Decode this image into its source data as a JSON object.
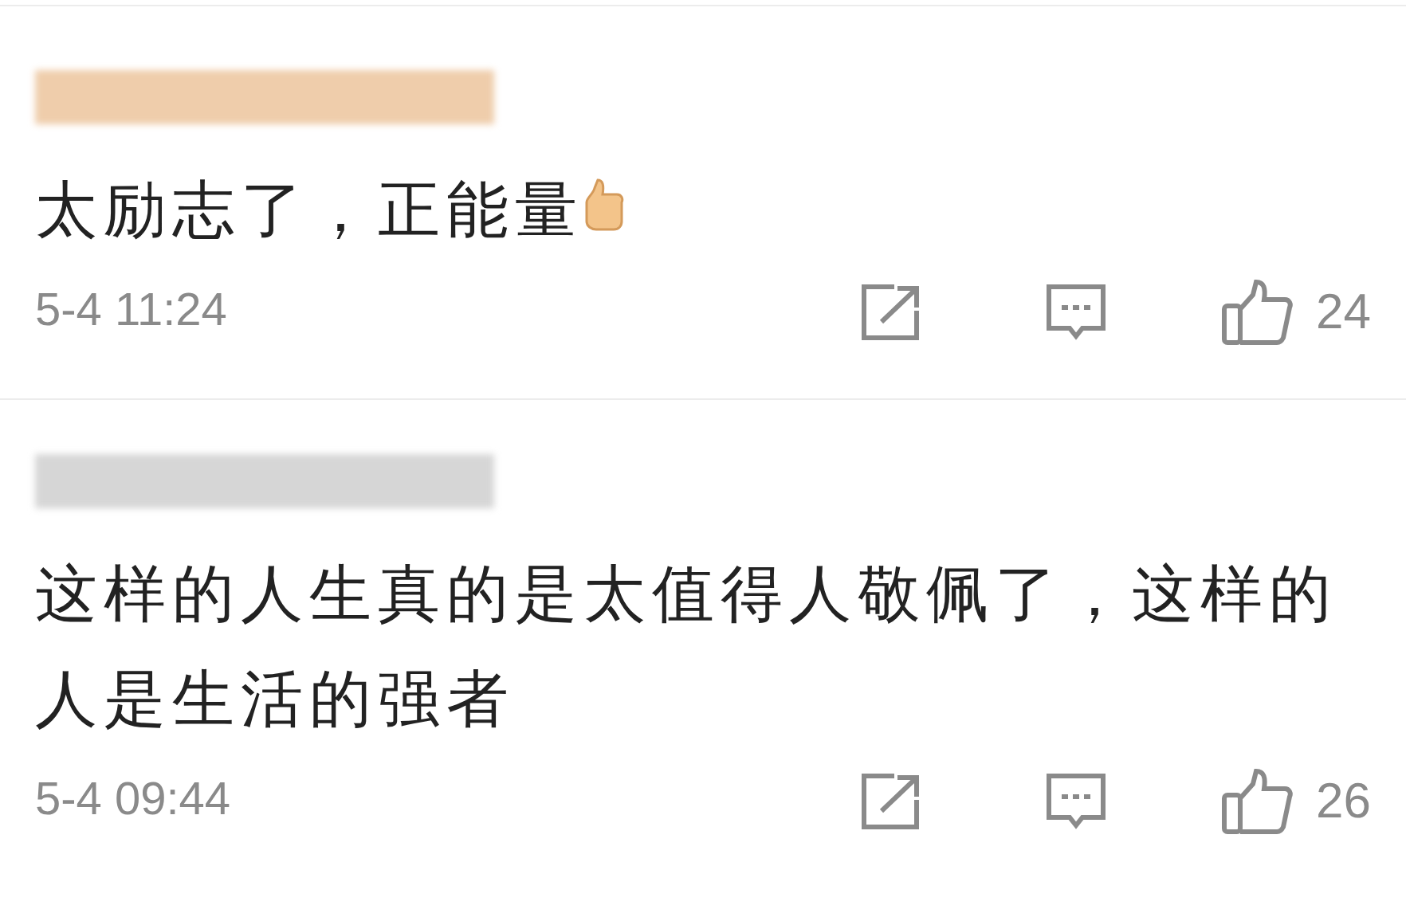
{
  "comments": [
    {
      "color": "#efcdab",
      "kind": "with-emoji",
      "text": "太励志了，正能量",
      "time": "5-4 11:24",
      "likes": "24"
    },
    {
      "color": "#d6d6d6",
      "kind": "plain",
      "text": "这样的人生真的是太值得人敬佩了，这样的人是生活的强者",
      "time": "5-4 09:44",
      "likes": "26"
    }
  ]
}
